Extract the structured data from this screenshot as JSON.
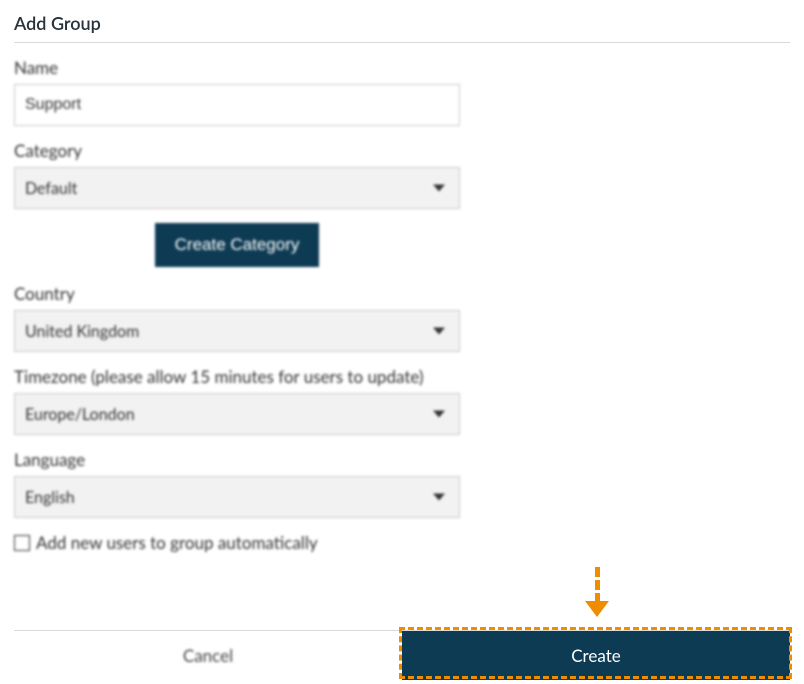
{
  "title": "Add Group",
  "name": {
    "label": "Name",
    "value": "Support"
  },
  "category": {
    "label": "Category",
    "value": "Default",
    "create_button": "Create Category"
  },
  "country": {
    "label": "Country",
    "value": "United Kingdom"
  },
  "timezone": {
    "label": "Timezone (please allow 15 minutes for users to update)",
    "value": "Europe/London"
  },
  "language": {
    "label": "Language",
    "value": "English"
  },
  "auto_add": {
    "label": "Add new users to group automatically",
    "checked": false
  },
  "footer": {
    "cancel": "Cancel",
    "create": "Create"
  },
  "accent": {
    "highlight": "#f08c00",
    "primary": "#0e3b54"
  }
}
